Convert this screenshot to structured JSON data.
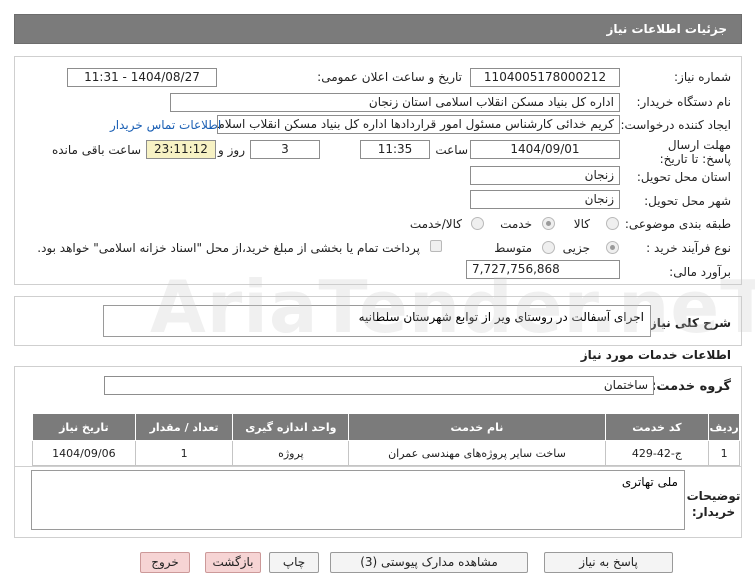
{
  "header": {
    "title": "جزئیات اطلاعات نیاز"
  },
  "form": {
    "need_number_label": "شماره نیاز:",
    "need_number": "1104005178000212",
    "announce_label": "تاریخ و ساعت اعلان عمومی:",
    "announce_value": "1404/08/27 - 11:31",
    "buyer_label": "نام دستگاه خریدار:",
    "buyer_value": "اداره کل بنیاد مسکن انقلاب اسلامی استان زنجان",
    "creator_label": "ایجاد کننده درخواست:",
    "creator_value": "کریم خدائی کارشناس مسئول امور قراردادها اداره کل بنیاد مسکن انقلاب اسلامی",
    "contact_link": "اطلاعات تماس خریدار",
    "deadline_label": "مهلت ارسال پاسخ: تا تاریخ:",
    "deadline_date": "1404/09/01",
    "time_label": "ساعت",
    "deadline_time": "11:35",
    "days_value": "3",
    "days_label": "روز و",
    "remaining_time": "23:11:12",
    "remaining_label": "ساعت باقی مانده",
    "province_label": "استان محل تحویل:",
    "province_value": "زنجان",
    "city_label": "شهر محل تحویل:",
    "city_value": "زنجان",
    "category_label": "طبقه بندی موضوعی:",
    "cat_goods": "کالا",
    "cat_service": "خدمت",
    "cat_goods_service": "کالا/خدمت",
    "process_label": "نوع فرآیند خرید :",
    "proc_partial": "جزیی",
    "proc_medium": "متوسط",
    "payment_note": "پرداخت تمام یا بخشی از مبلغ خرید،از محل \"اسناد خزانه اسلامی\" خواهد بود.",
    "estimate_label": "برآورد مالی:",
    "estimate_value": "7,727,756,868"
  },
  "summary": {
    "label": "شرح کلی نیاز:",
    "value": "اجرای آسفالت در روستای ویر از توابع شهرستان سلطانیه"
  },
  "services": {
    "section_title": "اطلاعات خدمات مورد نیاز",
    "group_label": "گروه خدمت:",
    "group_value": "ساختمان",
    "columns": [
      "ردیف",
      "کد خدمت",
      "نام خدمت",
      "واحد اندازه گیری",
      "تعداد / مقدار",
      "تاریخ نیاز"
    ],
    "rows": [
      [
        "1",
        "ج-42-429",
        "ساخت سایر پروژه‌های مهندسی عمران",
        "پروژه",
        "1",
        "1404/09/06"
      ]
    ]
  },
  "buyer_notes": {
    "label": "توضیحات خریدار:",
    "value": "ملی تهاتری"
  },
  "buttons": {
    "reply": "پاسخ به نیاز",
    "docs": "مشاهده مدارک پیوستی (3)",
    "print": "چاپ",
    "back": "بازگشت",
    "exit": "خروج"
  },
  "watermark": "AriaTender.neT"
}
